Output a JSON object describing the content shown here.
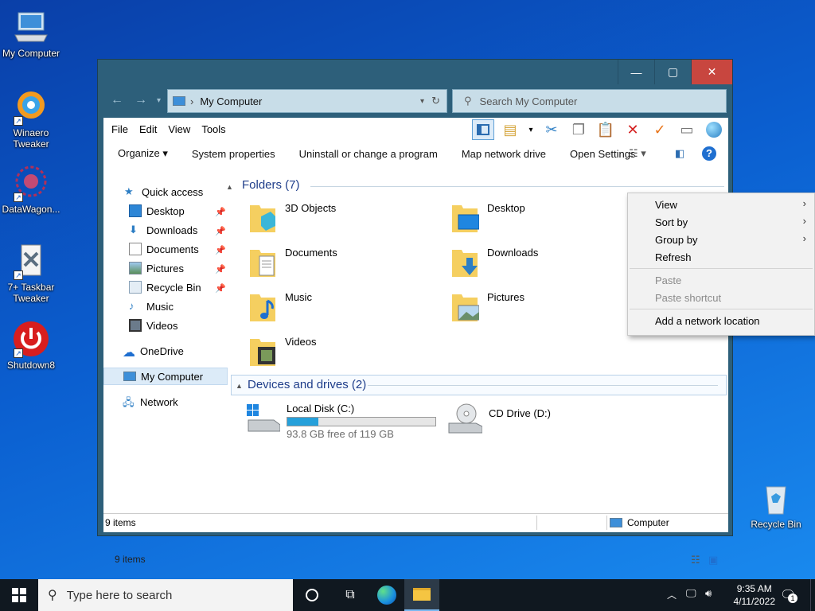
{
  "desktop": {
    "icons": [
      {
        "label": "My Computer"
      },
      {
        "label": "Winaero Tweaker"
      },
      {
        "label": "DataWagon..."
      },
      {
        "label": "7+ Taskbar Tweaker"
      },
      {
        "label": "Shutdown8"
      },
      {
        "label": "Recycle Bin"
      }
    ]
  },
  "window": {
    "controls": {
      "minimize": "—",
      "maximize": "▢",
      "close": "✕"
    },
    "address": {
      "path": "My Computer",
      "separator": "›"
    },
    "search": {
      "placeholder": "Search My Computer"
    },
    "menu": [
      "File",
      "Edit",
      "View",
      "Tools"
    ],
    "commands": [
      "Organize ▾",
      "System properties",
      "Uninstall or change a program",
      "Map network drive",
      "Open Settings"
    ],
    "nav": {
      "quick_access": "Quick access",
      "items": [
        {
          "label": "Desktop",
          "pinned": true
        },
        {
          "label": "Downloads",
          "pinned": true
        },
        {
          "label": "Documents",
          "pinned": true
        },
        {
          "label": "Pictures",
          "pinned": true
        },
        {
          "label": "Recycle Bin",
          "pinned": true
        },
        {
          "label": "Music",
          "pinned": false
        },
        {
          "label": "Videos",
          "pinned": false
        }
      ],
      "onedrive": "OneDrive",
      "this_pc": "My Computer",
      "network": "Network"
    },
    "folders_header": "Folders (7)",
    "folders": [
      {
        "name": "3D Objects"
      },
      {
        "name": "Desktop"
      },
      {
        "name": "Documents"
      },
      {
        "name": "Downloads"
      },
      {
        "name": "Music"
      },
      {
        "name": "Pictures"
      },
      {
        "name": "Videos"
      }
    ],
    "devices_header": "Devices and drives (2)",
    "drives": [
      {
        "name": "Local Disk (C:)",
        "free": "93.8 GB free of 119 GB",
        "used_fraction": 0.21
      },
      {
        "name": "CD Drive (D:)"
      }
    ],
    "status_count": "9 items",
    "status_count_bottom": "9 items",
    "status_location": "Computer"
  },
  "context_menu": {
    "items": [
      {
        "label": "View",
        "submenu": true,
        "enabled": true
      },
      {
        "label": "Sort by",
        "submenu": true,
        "enabled": true
      },
      {
        "label": "Group by",
        "submenu": true,
        "enabled": true
      },
      {
        "label": "Refresh",
        "submenu": false,
        "enabled": true
      },
      {
        "label": "Paste",
        "submenu": false,
        "enabled": false
      },
      {
        "label": "Paste shortcut",
        "submenu": false,
        "enabled": false
      },
      {
        "label": "Add a network location",
        "submenu": false,
        "enabled": true
      }
    ]
  },
  "taskbar": {
    "search_placeholder": "Type here to search",
    "time": "9:35 AM",
    "date": "4/11/2022",
    "notification_count": "1"
  },
  "colors": {
    "accent": "#1e3d8a",
    "window_frame": "#2d5f7a",
    "close_button": "#c8463f",
    "drive_bar": "#26a0da"
  }
}
